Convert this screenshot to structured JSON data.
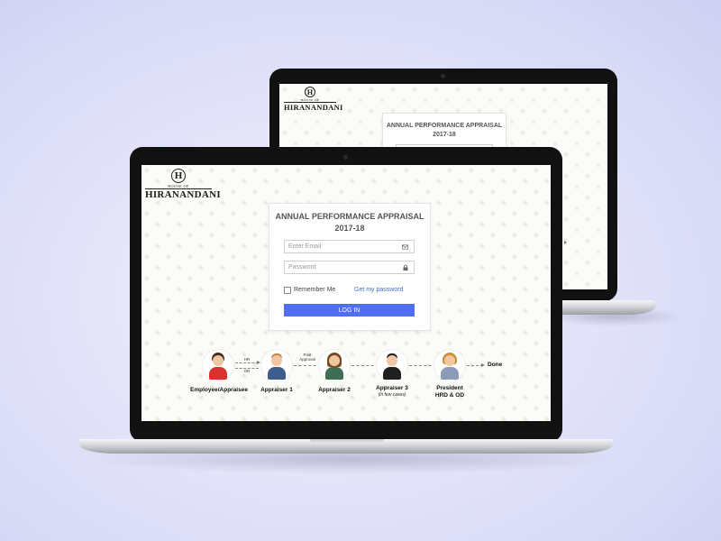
{
  "colors": {
    "background": "#dfe1f8",
    "login_button": "#4f6ef1",
    "link": "#3f6fd6"
  },
  "logo": {
    "mark": "H",
    "house_of": "HOUSE OF",
    "name": "HIRANANDANI"
  },
  "login": {
    "title_line1": "ANNUAL PERFORMANCE APPRAISAL",
    "title_line2": "2017-18",
    "email_placeholder": "Enter Email",
    "email_icon": "envelope-icon",
    "password_placeholder": "Password",
    "password_icon": "lock-icon",
    "remember_me": "Remember Me",
    "forgot_password": "Get my password",
    "login_button": "LOG IN"
  },
  "workflow": {
    "steps": [
      {
        "label": "Employee/Appraisee",
        "note": ""
      },
      {
        "label": "Appraiser 1",
        "note": ""
      },
      {
        "label": "Appraiser 2",
        "note": ""
      },
      {
        "label": "Appraiser 3",
        "note": "(in few cases)"
      },
      {
        "label_line1": "President",
        "label_line2": "HRD & OD",
        "note": ""
      }
    ],
    "connector_hr": "HR",
    "connector_or": "OR",
    "connector_post_approval_1": "Post",
    "connector_post_approval_2": "Approval",
    "end_label": "Done"
  }
}
